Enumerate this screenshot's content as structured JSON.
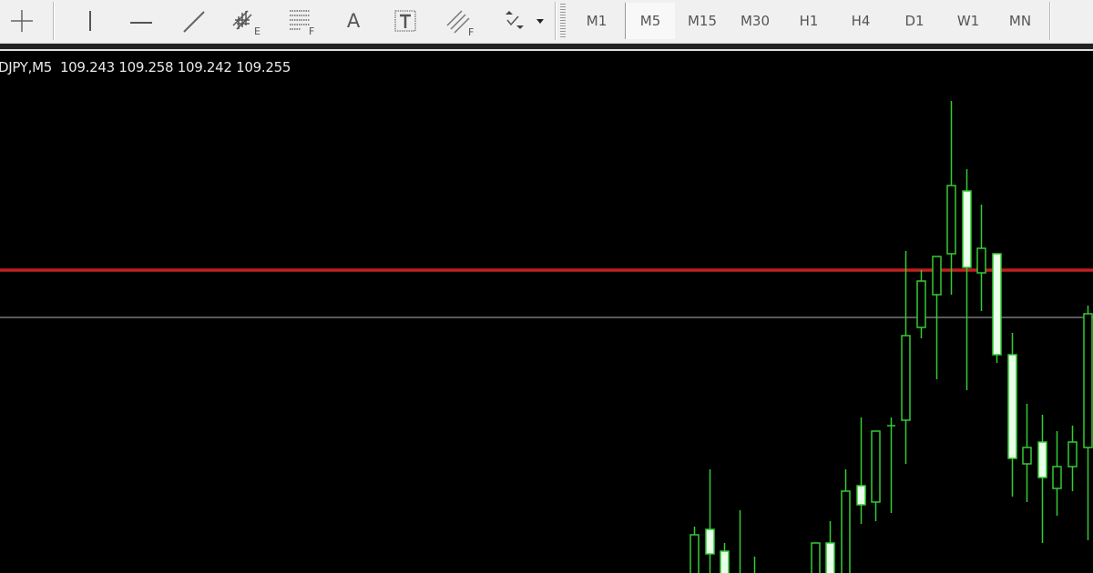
{
  "toolbar": {
    "tools": [
      {
        "name": "crosshair",
        "icon": "crosshair-icon"
      },
      {
        "name": "vertical-line",
        "icon": "vertical-line-icon"
      },
      {
        "name": "horizontal-line",
        "icon": "horizontal-line-icon"
      },
      {
        "name": "trendline",
        "icon": "trendline-icon"
      },
      {
        "name": "equidistant-channel",
        "icon": "equidistant-channel-icon",
        "suffix": "E"
      },
      {
        "name": "fibonacci-retracement",
        "icon": "fibonacci-retracement-icon",
        "suffix": "F"
      },
      {
        "name": "text",
        "icon": "text-icon",
        "label": "A"
      },
      {
        "name": "text-label",
        "icon": "text-label-icon",
        "label": "T"
      },
      {
        "name": "fibonacci-fan",
        "icon": "fibonacci-fan-icon",
        "suffix": "F"
      },
      {
        "name": "arrows",
        "icon": "arrows-dropdown-icon"
      }
    ],
    "timeframes": [
      "M1",
      "M5",
      "M15",
      "M30",
      "H1",
      "H4",
      "D1",
      "W1",
      "MN"
    ],
    "active_timeframe": "M5"
  },
  "chart": {
    "info": "DJPY,M5  109.243 109.258 109.242 109.255",
    "background": "#000000",
    "candle_color": "#33cc33",
    "bear_fill": "#eaffea",
    "red_line": {
      "price": 109.272,
      "color": "#c0201e"
    },
    "bid_line": {
      "price": 109.255,
      "color": "#77787f"
    }
  },
  "chart_data": {
    "type": "candlestick",
    "symbol_timeframe": "DJPY,M5",
    "ohlc_header": {
      "open": 109.243,
      "high": 109.258,
      "low": 109.242,
      "close": 109.255
    },
    "candles": [
      {
        "o": 109.151,
        "h": 109.178,
        "l": 109.144,
        "c": 109.175
      },
      {
        "o": 109.177,
        "h": 109.199,
        "l": 109.158,
        "c": 109.168
      },
      {
        "o": 109.169,
        "h": 109.172,
        "l": 109.151,
        "c": 109.156
      },
      {
        "o": 109.158,
        "h": 109.184,
        "l": 109.149,
        "c": 109.159
      },
      {
        "o": 109.154,
        "h": 109.167,
        "l": 109.148,
        "c": 109.158
      },
      {
        "o": 109.154,
        "h": 109.172,
        "l": 109.149,
        "c": 109.172
      },
      {
        "o": 109.172,
        "h": 109.18,
        "l": 109.151,
        "c": 109.156
      },
      {
        "o": 109.154,
        "h": 109.199,
        "l": 109.151,
        "c": 109.191
      },
      {
        "o": 109.193,
        "h": 109.218,
        "l": 109.179,
        "c": 109.186
      },
      {
        "o": 109.187,
        "h": 109.213,
        "l": 109.18,
        "c": 109.213
      },
      {
        "o": 109.215,
        "h": 109.218,
        "l": 109.183,
        "c": 109.215
      },
      {
        "o": 109.217,
        "h": 109.279,
        "l": 109.201,
        "c": 109.248
      },
      {
        "o": 109.251,
        "h": 109.272,
        "l": 109.247,
        "c": 109.268
      },
      {
        "o": 109.263,
        "h": 109.277,
        "l": 109.232,
        "c": 109.277
      },
      {
        "o": 109.278,
        "h": 109.334,
        "l": 109.263,
        "c": 109.303
      },
      {
        "o": 109.301,
        "h": 109.309,
        "l": 109.228,
        "c": 109.273
      },
      {
        "o": 109.271,
        "h": 109.296,
        "l": 109.257,
        "c": 109.28
      },
      {
        "o": 109.278,
        "h": 109.278,
        "l": 109.238,
        "c": 109.241
      },
      {
        "o": 109.241,
        "h": 109.249,
        "l": 109.189,
        "c": 109.203
      },
      {
        "o": 109.201,
        "h": 109.223,
        "l": 109.187,
        "c": 109.207
      },
      {
        "o": 109.209,
        "h": 109.219,
        "l": 109.172,
        "c": 109.196
      },
      {
        "o": 109.192,
        "h": 109.213,
        "l": 109.182,
        "c": 109.2
      },
      {
        "o": 109.2,
        "h": 109.215,
        "l": 109.191,
        "c": 109.209
      },
      {
        "o": 109.207,
        "h": 109.259,
        "l": 109.173,
        "c": 109.256
      }
    ]
  }
}
